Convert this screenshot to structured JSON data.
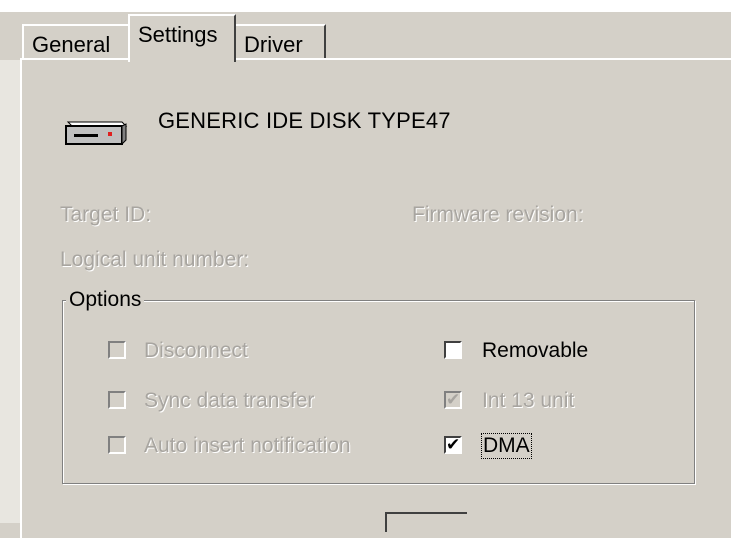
{
  "tabs": [
    {
      "label": "General"
    },
    {
      "label": "Settings"
    },
    {
      "label": "Driver"
    }
  ],
  "device": {
    "name": "GENERIC IDE  DISK TYPE47",
    "icon": "hard-disk-icon"
  },
  "info": {
    "target_id_label": "Target ID:",
    "firmware_label": "Firmware revision:",
    "lun_label": "Logical unit number:"
  },
  "options": {
    "legend": "Options",
    "items": [
      {
        "label": "Disconnect",
        "checked": false,
        "enabled": false
      },
      {
        "label": "Sync data transfer",
        "checked": false,
        "enabled": false
      },
      {
        "label": "Auto insert notification",
        "checked": false,
        "enabled": false
      },
      {
        "label": "Removable",
        "checked": false,
        "enabled": true
      },
      {
        "label": "Int 13 unit",
        "checked": true,
        "enabled": false
      },
      {
        "label": "DMA",
        "checked": true,
        "enabled": true
      }
    ]
  }
}
